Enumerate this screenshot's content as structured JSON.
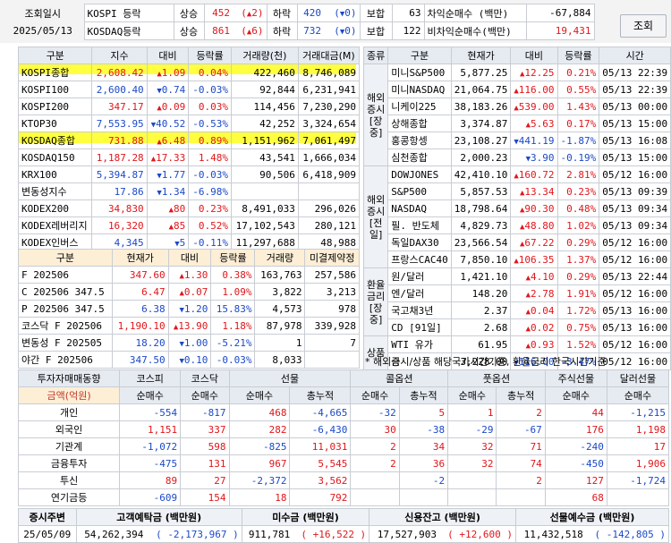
{
  "header": {
    "date_label": "조회일시",
    "date": "2025/05/13",
    "rows": [
      {
        "market": "KOSPI 등락",
        "up_label": "상승",
        "up": "452",
        "up_limit": "2",
        "down_label": "하락",
        "down": "420",
        "down_limit": "0",
        "flat_label": "보합",
        "flat": "63",
        "prog_label": "차익순매수 (백만)",
        "prog": "-67,884"
      },
      {
        "market": "KOSDAQ등락",
        "up_label": "상승",
        "up": "861",
        "up_limit": "6",
        "down_label": "하락",
        "down": "732",
        "down_limit": "0",
        "flat_label": "보합",
        "flat": "122",
        "prog_label": "비차익순매수(백만)",
        "prog": "19,431"
      }
    ],
    "refresh": "조회"
  },
  "index_table": {
    "headers": [
      "구분",
      "지수",
      "대비",
      "등락률",
      "거래량(천)",
      "거래대금(M)"
    ],
    "rows": [
      [
        "KOSPI종합",
        "2,608.42",
        "up",
        "1.09",
        "0.04%",
        "422,460",
        "8,746,089"
      ],
      [
        "KOSPI100",
        "2,600.40",
        "dn",
        "0.74",
        "-0.03%",
        "92,844",
        "6,231,941"
      ],
      [
        "KOSPI200",
        "347.17",
        "up",
        "0.09",
        "0.03%",
        "114,456",
        "7,230,290"
      ],
      [
        "KTOP30",
        "7,553.95",
        "dn",
        "40.52",
        "-0.53%",
        "42,252",
        "3,324,654"
      ],
      [
        "KOSDAQ종합",
        "731.88",
        "up",
        "6.48",
        "0.89%",
        "1,151,962",
        "7,061,497"
      ],
      [
        "KOSDAQ150",
        "1,187.28",
        "up",
        "17.33",
        "1.48%",
        "43,541",
        "1,666,034"
      ],
      [
        "KRX100",
        "5,394.87",
        "dn",
        "1.77",
        "-0.03%",
        "90,506",
        "6,418,909"
      ],
      [
        "변동성지수",
        "17.86",
        "dn",
        "1.34",
        "-6.98%",
        "",
        ""
      ],
      [
        "KODEX200",
        "34,830",
        "up",
        "80",
        "0.23%",
        "8,491,033",
        "296,026"
      ],
      [
        "KODEX레버리지",
        "16,320",
        "up",
        "85",
        "0.52%",
        "17,102,543",
        "280,121"
      ],
      [
        "KODEX인버스",
        "4,345",
        "dn",
        "5",
        "-0.11%",
        "11,297,688",
        "48,988"
      ]
    ]
  },
  "futures_table": {
    "headers": [
      "구분",
      "현재가",
      "대비",
      "등락률",
      "거래량",
      "미결제약정"
    ],
    "rows": [
      [
        "F 202506",
        "347.60",
        "up",
        "1.30",
        "0.38%",
        "163,763",
        "257,586"
      ],
      [
        "C 202506 347.5",
        "6.47",
        "up",
        "0.07",
        "1.09%",
        "3,822",
        "3,213"
      ],
      [
        "P 202506 347.5",
        "6.38",
        "dn",
        "1.20",
        "15.83%",
        "4,573",
        "978"
      ],
      [
        "코스닥 F 202506",
        "1,190.10",
        "up",
        "13.90",
        "1.18%",
        "87,978",
        "339,928"
      ],
      [
        "변동성 F 202505",
        "18.20",
        "dn",
        "1.00",
        "-5.21%",
        "1",
        "7"
      ],
      [
        "야간 F 202506",
        "347.50",
        "dn",
        "0.10",
        "-0.03%",
        "8,033",
        ""
      ]
    ]
  },
  "overseas_table": {
    "headers": [
      "종류",
      "구분",
      "현재가",
      "대비",
      "등락률",
      "시간"
    ],
    "groups": [
      {
        "cat": "해외 증시 [장중]",
        "rows": [
          [
            "미니S&P500",
            "5,877.25",
            "up",
            "12.25",
            "0.21%",
            "05/13 22:39"
          ],
          [
            "미니NASDAQ",
            "21,064.75",
            "up",
            "116.00",
            "0.55%",
            "05/13 22:39"
          ],
          [
            "니케이225",
            "38,183.26",
            "up",
            "539.00",
            "1.43%",
            "05/13 00:00"
          ],
          [
            "상해종합",
            "3,374.87",
            "up",
            "5.63",
            "0.17%",
            "05/13 15:00"
          ],
          [
            "홍콩항셍",
            "23,108.27",
            "dn",
            "441.19",
            "-1.87%",
            "05/13 16:08"
          ],
          [
            "심천종합",
            "2,000.23",
            "dn",
            "3.90",
            "-0.19%",
            "05/13 15:00"
          ]
        ]
      },
      {
        "cat": "해외 증시 [전일]",
        "rows": [
          [
            "DOWJONES",
            "42,410.10",
            "up",
            "160.72",
            "2.81%",
            "05/12 16:00"
          ],
          [
            "S&P500",
            "5,857.53",
            "up",
            "13.34",
            "0.23%",
            "05/13 09:39"
          ],
          [
            "NASDAQ",
            "18,798.64",
            "up",
            "90.30",
            "0.48%",
            "05/13 09:34"
          ],
          [
            "필. 반도체",
            "4,829.73",
            "up",
            "48.80",
            "1.02%",
            "05/13 09:34"
          ],
          [
            "독일DAX30",
            "23,566.54",
            "up",
            "67.22",
            "0.29%",
            "05/12 16:00"
          ],
          [
            "프랑스CAC40",
            "7,850.10",
            "up",
            "106.35",
            "1.37%",
            "05/12 16:00"
          ]
        ]
      },
      {
        "cat": "환율 금리 [장중]",
        "rows": [
          [
            "원/달러",
            "1,421.10",
            "up",
            "4.10",
            "0.29%",
            "05/13 22:44"
          ],
          [
            "엔/달러",
            "148.20",
            "up",
            "2.78",
            "1.91%",
            "05/12 16:00"
          ],
          [
            "국고채3년",
            "2.37",
            "up",
            "0.04",
            "1.72%",
            "05/13 16:00"
          ],
          [
            "CD [91일]",
            "2.68",
            "up",
            "0.02",
            "0.75%",
            "05/13 16:00"
          ]
        ]
      },
      {
        "cat": "상품",
        "rows": [
          [
            "WTI 유가",
            "61.95",
            "up",
            "0.93",
            "1.52%",
            "05/12 16:00"
          ],
          [
            "금",
            "3,228.00",
            "dn",
            "116.00",
            "-3.47%",
            "05/12 16:00"
          ]
        ]
      }
    ],
    "note": "* 해외증시/상품 해당국가시간기준, 환율금리 한국시간기준"
  },
  "investor_table": {
    "title": "투자자매매동향",
    "groups": [
      "코스피",
      "코스닥",
      "선물",
      "콜옵션",
      "풋옵션",
      "주식선물",
      "달러선물"
    ],
    "sub_label": "금액(억원)",
    "subs": [
      "순매수",
      "순매수",
      "순매수",
      "총누적",
      "순매수",
      "총누적",
      "순매수",
      "총누적",
      "순매수",
      "순매수"
    ],
    "rows": [
      [
        "개인",
        "-554",
        "-817",
        "468",
        "-4,665",
        "-32",
        "5",
        "1",
        "2",
        "44",
        "-1,215"
      ],
      [
        "외국인",
        "1,151",
        "337",
        "282",
        "-6,430",
        "30",
        "-38",
        "-29",
        "-67",
        "176",
        "1,198"
      ],
      [
        "기관계",
        "-1,072",
        "598",
        "-825",
        "11,031",
        "2",
        "34",
        "32",
        "71",
        "-240",
        "17"
      ],
      [
        "금융투자",
        "-475",
        "131",
        "967",
        "5,545",
        "2",
        "36",
        "32",
        "74",
        "-450",
        "1,906"
      ],
      [
        "투신",
        "89",
        "27",
        "-2,372",
        "3,562",
        "",
        "-2",
        "",
        "2",
        "127",
        "-1,724"
      ],
      [
        "연기금등",
        "-609",
        "154",
        "18",
        "792",
        "",
        "",
        "",
        "",
        "68",
        ""
      ]
    ]
  },
  "bottom": {
    "headers": [
      "증시주변",
      "고객예탁금 (백만원)",
      "미수금 (백만원)",
      "신용잔고 (백만원)",
      "선물예수금 (백만원)"
    ],
    "date": "25/05/09",
    "deposit": "54,262,394",
    "deposit_chg": "-2,173,967",
    "unpaid": "911,781",
    "unpaid_chg": "+16,522",
    "credit": "17,527,903",
    "credit_chg": "+12,600",
    "fut_dep": "11,432,518",
    "fut_dep_chg": "-142,805"
  }
}
